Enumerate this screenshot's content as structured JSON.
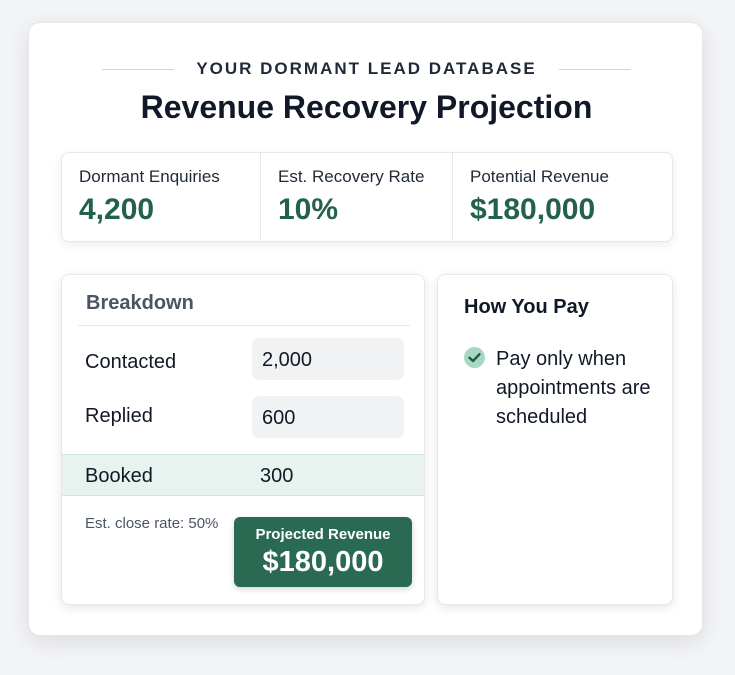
{
  "header": {
    "eyebrow": "YOUR DORMANT LEAD DATABASE",
    "title": "Revenue Recovery Projection"
  },
  "stats": [
    {
      "label": "Dormant Enquiries",
      "value": "4,200"
    },
    {
      "label": "Est. Recovery Rate",
      "value": "10%"
    },
    {
      "label": "Potential Revenue",
      "value": "$180,000"
    }
  ],
  "breakdown": {
    "title": "Breakdown",
    "rows": [
      {
        "label": "Contacted",
        "value": "2,000"
      },
      {
        "label": "Replied",
        "value": "600"
      }
    ],
    "booked": {
      "label": "Booked",
      "value": "300"
    },
    "close_rate": "Est. close rate: 50%",
    "projected": {
      "label": "Projected Revenue",
      "value": "$180,000"
    }
  },
  "pay": {
    "title": "How You Pay",
    "icon": "check-circle-icon",
    "text": "Pay only when appointments are scheduled"
  },
  "colors": {
    "accent_green": "#24614a",
    "projected_bg": "#2a6a52",
    "booked_bg": "#e8f3ef",
    "check_bg": "#a8d7c4"
  }
}
